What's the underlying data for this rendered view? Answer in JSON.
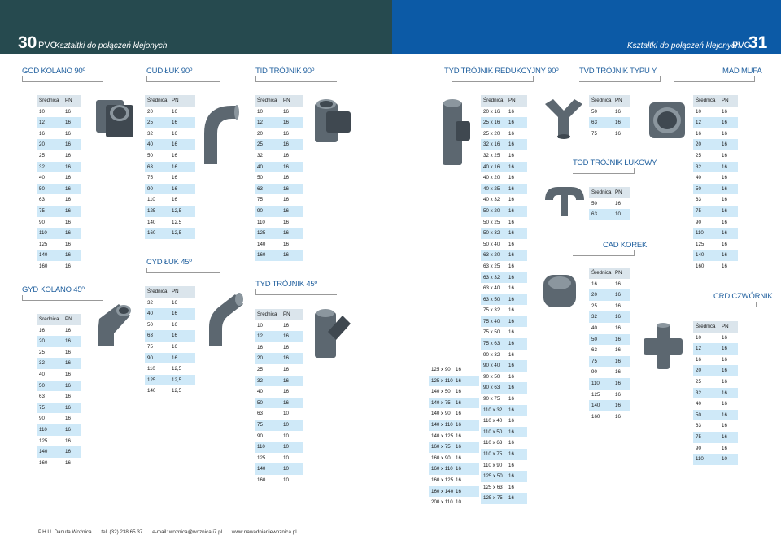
{
  "header": {
    "left_page_number": "30",
    "left_pvc": "PVC",
    "left_subtitle": "Kształtki do połączeń klejonych",
    "right_subtitle": "Kształtki do połączeń klejonych",
    "right_pvc": "PVC",
    "right_page_number": "31"
  },
  "colors": {
    "left_header": "#264a4f",
    "right_header": "#0c5aa6",
    "title": "#1f5f9e",
    "row_alt": "#cfe9f8"
  },
  "col_headers": {
    "srednica": "Średnica",
    "pn": "PN"
  },
  "sections": {
    "god": {
      "title": "GOD KOLANO 90º",
      "rows": [
        [
          "10",
          "16"
        ],
        [
          "12",
          "16"
        ],
        [
          "16",
          "16"
        ],
        [
          "20",
          "16"
        ],
        [
          "25",
          "16"
        ],
        [
          "32",
          "16"
        ],
        [
          "40",
          "16"
        ],
        [
          "50",
          "16"
        ],
        [
          "63",
          "16"
        ],
        [
          "75",
          "16"
        ],
        [
          "90",
          "16"
        ],
        [
          "110",
          "16"
        ],
        [
          "125",
          "16"
        ],
        [
          "140",
          "16"
        ],
        [
          "160",
          "16"
        ]
      ]
    },
    "gyd": {
      "title": "GYD KOLANO 45º",
      "rows": [
        [
          "16",
          "16"
        ],
        [
          "20",
          "16"
        ],
        [
          "25",
          "16"
        ],
        [
          "32",
          "16"
        ],
        [
          "40",
          "16"
        ],
        [
          "50",
          "16"
        ],
        [
          "63",
          "16"
        ],
        [
          "75",
          "16"
        ],
        [
          "90",
          "16"
        ],
        [
          "110",
          "16"
        ],
        [
          "125",
          "16"
        ],
        [
          "140",
          "16"
        ],
        [
          "160",
          "16"
        ]
      ]
    },
    "cud": {
      "title": "CUD ŁUK 90º",
      "rows": [
        [
          "20",
          "16"
        ],
        [
          "25",
          "16"
        ],
        [
          "32",
          "16"
        ],
        [
          "40",
          "16"
        ],
        [
          "50",
          "16"
        ],
        [
          "63",
          "16"
        ],
        [
          "75",
          "16"
        ],
        [
          "90",
          "16"
        ],
        [
          "110",
          "16"
        ],
        [
          "125",
          "12,5"
        ],
        [
          "140",
          "12,5"
        ],
        [
          "160",
          "12,5"
        ]
      ]
    },
    "cyd": {
      "title": "CYD ŁUK 45º",
      "rows": [
        [
          "32",
          "16"
        ],
        [
          "40",
          "16"
        ],
        [
          "50",
          "16"
        ],
        [
          "63",
          "16"
        ],
        [
          "75",
          "16"
        ],
        [
          "90",
          "16"
        ],
        [
          "110",
          "12,5"
        ],
        [
          "125",
          "12,5"
        ],
        [
          "140",
          "12,5"
        ]
      ]
    },
    "tid": {
      "title": "TID TRÓJNIK 90º",
      "rows": [
        [
          "10",
          "16"
        ],
        [
          "12",
          "16"
        ],
        [
          "20",
          "16"
        ],
        [
          "25",
          "16"
        ],
        [
          "32",
          "16"
        ],
        [
          "40",
          "16"
        ],
        [
          "50",
          "16"
        ],
        [
          "63",
          "16"
        ],
        [
          "75",
          "16"
        ],
        [
          "90",
          "16"
        ],
        [
          "110",
          "16"
        ],
        [
          "125",
          "16"
        ],
        [
          "140",
          "16"
        ],
        [
          "160",
          "16"
        ]
      ]
    },
    "tyd": {
      "title": "TYD TRÓJNIK 45º",
      "rows": [
        [
          "10",
          "16"
        ],
        [
          "12",
          "16"
        ],
        [
          "16",
          "16"
        ],
        [
          "20",
          "16"
        ],
        [
          "25",
          "16"
        ],
        [
          "32",
          "16"
        ],
        [
          "40",
          "16"
        ],
        [
          "50",
          "16"
        ],
        [
          "63",
          "10"
        ],
        [
          "75",
          "10"
        ],
        [
          "90",
          "10"
        ],
        [
          "110",
          "10"
        ],
        [
          "125",
          "10"
        ],
        [
          "140",
          "10"
        ],
        [
          "160",
          "10"
        ]
      ]
    },
    "tyd_red_a": {
      "rows": [
        [
          "125 x 90",
          "16"
        ],
        [
          "125 x 110",
          "16"
        ],
        [
          "140 x 50",
          "16"
        ],
        [
          "140 x 75",
          "16"
        ],
        [
          "140 x 90",
          "16"
        ],
        [
          "140 x 110",
          "16"
        ],
        [
          "140 x 125",
          "16"
        ],
        [
          "160 x 75",
          "16"
        ],
        [
          "160 x 90",
          "16"
        ],
        [
          "160 x 110",
          "16"
        ],
        [
          "160 x 125",
          "16"
        ],
        [
          "160 x 140",
          "16"
        ],
        [
          "200 x 110",
          "10"
        ]
      ]
    },
    "tyd_red_b": {
      "title": "TYD TRÓJNIK REDUKCYJNY 90º",
      "rows": [
        [
          "20 x 16",
          "16"
        ],
        [
          "25 x 16",
          "16"
        ],
        [
          "25 x 20",
          "16"
        ],
        [
          "32 x 16",
          "16"
        ],
        [
          "32 x 25",
          "16"
        ],
        [
          "40 x 16",
          "16"
        ],
        [
          "40 x 20",
          "16"
        ],
        [
          "40 x 25",
          "16"
        ],
        [
          "40 x 32",
          "16"
        ],
        [
          "50 x 20",
          "16"
        ],
        [
          "50 x 25",
          "16"
        ],
        [
          "50 x 32",
          "16"
        ],
        [
          "50 x 40",
          "16"
        ],
        [
          "63 x 20",
          "16"
        ],
        [
          "63 x 25",
          "16"
        ],
        [
          "63 x 32",
          "16"
        ],
        [
          "63 x 40",
          "16"
        ],
        [
          "63 x 50",
          "16"
        ],
        [
          "75 x 32",
          "16"
        ],
        [
          "75 x 40",
          "16"
        ],
        [
          "75 x 50",
          "16"
        ],
        [
          "75 x 63",
          "16"
        ],
        [
          "90 x 32",
          "16"
        ],
        [
          "90 x 40",
          "16"
        ],
        [
          "90 x 50",
          "16"
        ],
        [
          "90 x 63",
          "16"
        ],
        [
          "90 x 75",
          "16"
        ],
        [
          "110 x 32",
          "16"
        ],
        [
          "110 x 40",
          "16"
        ],
        [
          "110 x 50",
          "16"
        ],
        [
          "110 x 63",
          "16"
        ],
        [
          "110 x 75",
          "16"
        ],
        [
          "110 x 90",
          "16"
        ],
        [
          "125 x 50",
          "16"
        ],
        [
          "125 x 63",
          "16"
        ],
        [
          "125 x 75",
          "16"
        ]
      ]
    },
    "tvd": {
      "title": "TVD TRÓJNIK TYPU Y",
      "rows": [
        [
          "50",
          "16"
        ],
        [
          "63",
          "16"
        ],
        [
          "75",
          "16"
        ]
      ]
    },
    "tod": {
      "title": "TOD TRÓJNIK ŁUKOWY",
      "rows": [
        [
          "50",
          "16"
        ],
        [
          "63",
          "10"
        ]
      ]
    },
    "cad": {
      "title": "CAD KOREK",
      "rows": [
        [
          "16",
          "16"
        ],
        [
          "20",
          "16"
        ],
        [
          "25",
          "16"
        ],
        [
          "32",
          "16"
        ],
        [
          "40",
          "16"
        ],
        [
          "50",
          "16"
        ],
        [
          "63",
          "16"
        ],
        [
          "75",
          "16"
        ],
        [
          "90",
          "16"
        ],
        [
          "110",
          "16"
        ],
        [
          "125",
          "16"
        ],
        [
          "140",
          "16"
        ],
        [
          "160",
          "16"
        ]
      ]
    },
    "mad": {
      "title": "MAD MUFA",
      "rows": [
        [
          "10",
          "16"
        ],
        [
          "12",
          "16"
        ],
        [
          "16",
          "16"
        ],
        [
          "20",
          "16"
        ],
        [
          "25",
          "16"
        ],
        [
          "32",
          "16"
        ],
        [
          "40",
          "16"
        ],
        [
          "50",
          "16"
        ],
        [
          "63",
          "16"
        ],
        [
          "75",
          "16"
        ],
        [
          "90",
          "16"
        ],
        [
          "110",
          "16"
        ],
        [
          "125",
          "16"
        ],
        [
          "140",
          "16"
        ],
        [
          "160",
          "16"
        ]
      ]
    },
    "crd": {
      "title": "CRD CZWÓRNIK",
      "rows": [
        [
          "10",
          "16"
        ],
        [
          "12",
          "16"
        ],
        [
          "16",
          "16"
        ],
        [
          "20",
          "16"
        ],
        [
          "25",
          "16"
        ],
        [
          "32",
          "16"
        ],
        [
          "40",
          "16"
        ],
        [
          "50",
          "16"
        ],
        [
          "63",
          "16"
        ],
        [
          "75",
          "16"
        ],
        [
          "90",
          "16"
        ],
        [
          "110",
          "10"
        ]
      ]
    }
  },
  "footer": {
    "company": "P.H.U. Danuta Woźnica",
    "tel": "tel. (32) 238 65 37",
    "email": "e-mail: woznica@woznica.i7.pl",
    "web": "www.nawadnianiewoznica.pl"
  }
}
